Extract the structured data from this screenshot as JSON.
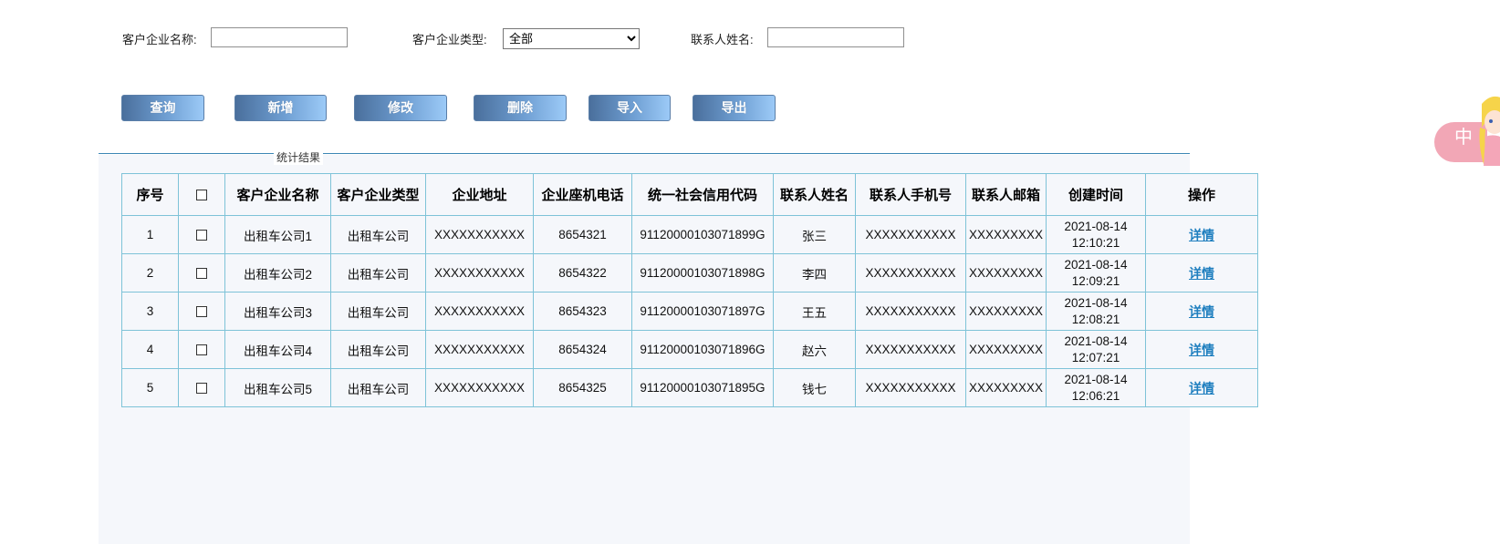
{
  "filters": {
    "company_name_label": "客户企业名称:",
    "company_name_value": "",
    "company_type_label": "客户企业类型:",
    "company_type_selected": "全部",
    "contact_name_label": "联系人姓名:",
    "contact_name_value": ""
  },
  "toolbar": {
    "query": "查询",
    "add": "新增",
    "edit": "修改",
    "delete": "删除",
    "import": "导入",
    "export": "导出"
  },
  "results": {
    "legend": "统计结果",
    "columns": [
      "序号",
      "",
      "客户企业名称",
      "客户企业类型",
      "企业地址",
      "企业座机电话",
      "统一社会信用代码",
      "联系人姓名",
      "联系人手机号",
      "联系人邮箱",
      "创建时间",
      "操作"
    ],
    "rows": [
      {
        "index": "1",
        "name": "出租车公司1",
        "type": "出租车公司",
        "address": "XXXXXXXXXXX",
        "phone": "8654321",
        "credit_code": "91120000103071899G",
        "contact": "张三",
        "mobile": "XXXXXXXXXXX",
        "email": "XXXXXXXXX",
        "date": "2021-08-14",
        "time": "12:10:21",
        "action": "详情"
      },
      {
        "index": "2",
        "name": "出租车公司2",
        "type": "出租车公司",
        "address": "XXXXXXXXXXX",
        "phone": "8654322",
        "credit_code": "91120000103071898G",
        "contact": "李四",
        "mobile": "XXXXXXXXXXX",
        "email": "XXXXXXXXX",
        "date": "2021-08-14",
        "time": "12:09:21",
        "action": "详情"
      },
      {
        "index": "3",
        "name": "出租车公司3",
        "type": "出租车公司",
        "address": "XXXXXXXXXXX",
        "phone": "8654323",
        "credit_code": "91120000103071897G",
        "contact": "王五",
        "mobile": "XXXXXXXXXXX",
        "email": "XXXXXXXXX",
        "date": "2021-08-14",
        "time": "12:08:21",
        "action": "详情"
      },
      {
        "index": "4",
        "name": "出租车公司4",
        "type": "出租车公司",
        "address": "XXXXXXXXXXX",
        "phone": "8654324",
        "credit_code": "91120000103071896G",
        "contact": "赵六",
        "mobile": "XXXXXXXXXXX",
        "email": "XXXXXXXXX",
        "date": "2021-08-14",
        "time": "12:07:21",
        "action": "详情"
      },
      {
        "index": "5",
        "name": "出租车公司5",
        "type": "出租车公司",
        "address": "XXXXXXXXXXX",
        "phone": "8654325",
        "credit_code": "91120000103071895G",
        "contact": "钱七",
        "mobile": "XXXXXXXXXXX",
        "email": "XXXXXXXXX",
        "date": "2021-08-14",
        "time": "12:06:21",
        "action": "详情"
      }
    ]
  },
  "widget": {
    "label": "中",
    "icon": "character-avatar-icon"
  },
  "colors": {
    "button_gradient_start": "#4a6f9c",
    "button_gradient_end": "#9ccaf7",
    "table_border": "#7ec3d8",
    "link": "#1f7fbf",
    "panel_bg": "#f5f7fb"
  }
}
